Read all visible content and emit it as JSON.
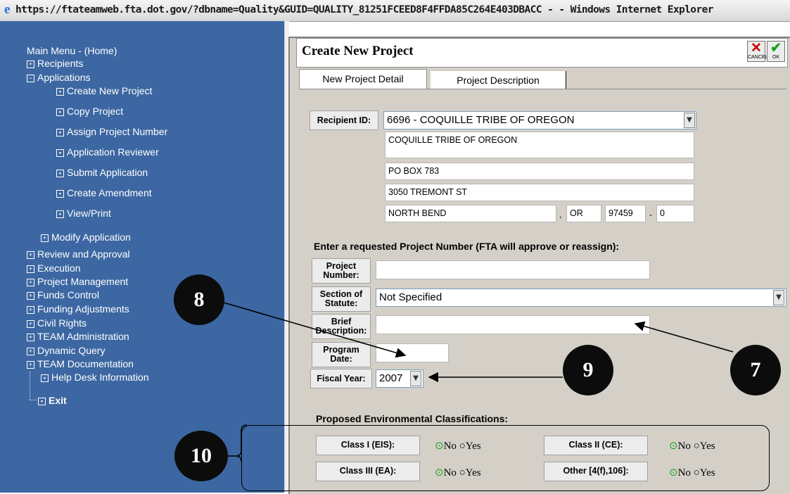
{
  "window": {
    "title": "https://ftateamweb.fta.dot.gov/?dbname=Quality&GUID=QUALITY_81251FCEED8F4FFDA85C264E403DBACC - - Windows Internet Explorer",
    "icon": "ie-icon"
  },
  "sidebar": {
    "home": "Main Menu - (Home)",
    "recipients": "Recipients",
    "applications": "Applications",
    "app_items": [
      "Create New Project",
      "Copy Project",
      "Assign Project Number",
      "Application Reviewer",
      "Submit Application",
      "Create Amendment",
      "View/Print"
    ],
    "modify": "Modify Application",
    "items": [
      "Review and Approval",
      "Execution",
      "Project Management",
      "Funds Control",
      "Funding Adjustments",
      "Civil Rights",
      "TEAM Administration",
      "Dynamic Query",
      "TEAM Documentation"
    ],
    "help_desk": "Help Desk Information",
    "exit": "Exit",
    "plus_glyph": "⊞",
    "minus_glyph": "⊟",
    "bullet_glyph": "⊡"
  },
  "header": {
    "title": "Create New Project",
    "cancel_label": "CANCEL",
    "ok_label": "OK"
  },
  "tabs": [
    "New Project Detail",
    "Project Description"
  ],
  "recipient": {
    "label": "Recipient ID:",
    "selected": "6696 - COQUILLE TRIBE OF OREGON",
    "name": "COQUILLE TRIBE OF OREGON",
    "address1": "PO BOX 783",
    "address2": "3050 TREMONT ST",
    "city": "NORTH BEND",
    "city_sep": ",",
    "state": "OR",
    "zip": "97459",
    "zip_sep": "-",
    "zip4": "0"
  },
  "project": {
    "heading": "Enter a requested Project Number (FTA will approve or reassign):",
    "number_label": "Project Number:",
    "number_value": "",
    "statute_label": "Section of Statute:",
    "statute_value": "Not Specified",
    "brief_label": "Brief Description:",
    "brief_value": "",
    "program_label": "Program Date:",
    "program_value": "",
    "fiscal_label": "Fiscal Year:",
    "fiscal_value": "2007"
  },
  "environment": {
    "heading": "Proposed Environmental Classifications:",
    "classes": [
      {
        "label": "Class I (EIS):",
        "selected": "No"
      },
      {
        "label": "Class II (CE):",
        "selected": "No"
      },
      {
        "label": "Class III (EA):",
        "selected": "No"
      },
      {
        "label": "Other [4(f),106]:",
        "selected": "No"
      }
    ],
    "no_label": "No",
    "yes_label": "Yes",
    "checked_glyph": "⊙",
    "unchecked_glyph": "○"
  },
  "callouts": [
    "8",
    "7",
    "9",
    "10"
  ],
  "colors": {
    "sidebar_bg": "#3c67a2",
    "panel_bg": "#d4d0c8",
    "cancel_red": "#cc0000",
    "ok_green": "#1aa31a"
  }
}
